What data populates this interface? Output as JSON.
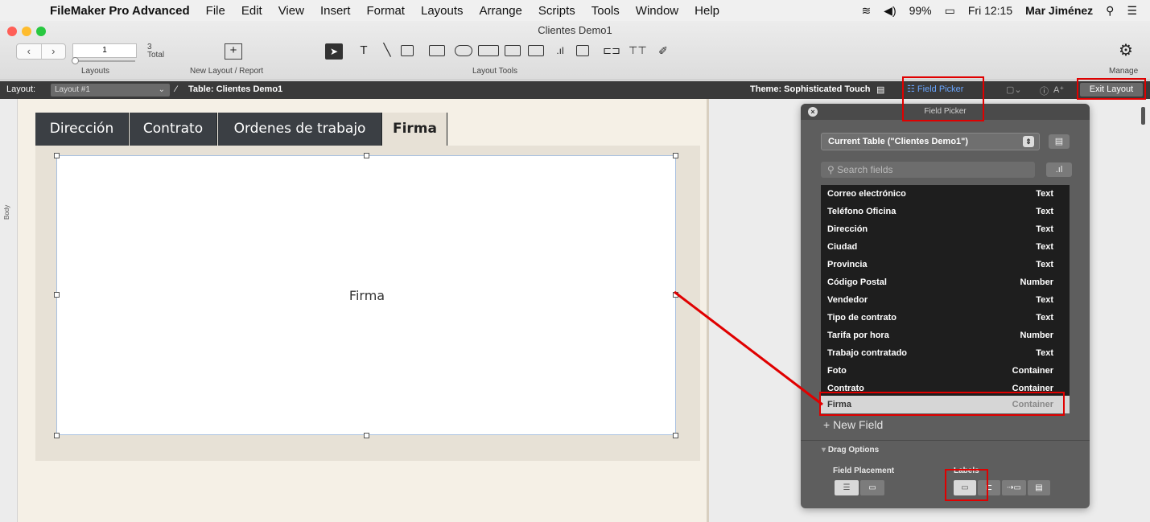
{
  "menubar": {
    "app_name": "FileMaker Pro Advanced",
    "items": [
      "File",
      "Edit",
      "View",
      "Insert",
      "Format",
      "Layouts",
      "Arrange",
      "Scripts",
      "Tools",
      "Window",
      "Help"
    ],
    "battery": "99%",
    "clock": "Fri 12:15",
    "user": "Mar Jiménez"
  },
  "window": {
    "title": "Clientes Demo1"
  },
  "toolbar": {
    "layout_number": "1",
    "layout_total": "3",
    "total_label": "Total",
    "layouts_label": "Layouts",
    "new_layout_label": "New Layout / Report",
    "layout_tools_label": "Layout Tools",
    "manage_label": "Manage"
  },
  "layoutbar": {
    "layout_label": "Layout:",
    "layout_value": "Layout #1",
    "table_label": "Table: Clientes Demo1",
    "theme_label": "Theme: Sophisticated Touch",
    "field_picker_btn": "Field Picker",
    "exit_layout_btn": "Exit Layout"
  },
  "canvas": {
    "part_label": "Body",
    "tabs": [
      {
        "label": "Dirección",
        "active": false
      },
      {
        "label": "Contrato",
        "active": false
      },
      {
        "label": "Ordenes de trabajo",
        "active": false
      },
      {
        "label": "Firma",
        "active": true
      }
    ],
    "field_label": "Firma"
  },
  "picker": {
    "title": "Field Picker",
    "table_select": "Current Table (\"Clientes Demo1\")",
    "search_placeholder": "Search fields",
    "fields": [
      {
        "name": "Correo electrónico",
        "type": "Text",
        "selected": false
      },
      {
        "name": "Teléfono Oficina",
        "type": "Text",
        "selected": false
      },
      {
        "name": "Dirección",
        "type": "Text",
        "selected": false
      },
      {
        "name": "Ciudad",
        "type": "Text",
        "selected": false
      },
      {
        "name": "Provincia",
        "type": "Text",
        "selected": false
      },
      {
        "name": "Código Postal",
        "type": "Number",
        "selected": false
      },
      {
        "name": "Vendedor",
        "type": "Text",
        "selected": false
      },
      {
        "name": "Tipo de contrato",
        "type": "Text",
        "selected": false
      },
      {
        "name": "Tarifa por hora",
        "type": "Number",
        "selected": false
      },
      {
        "name": "Trabajo contratado",
        "type": "Text",
        "selected": false
      },
      {
        "name": "Foto",
        "type": "Container",
        "selected": false
      },
      {
        "name": "Contrato",
        "type": "Container",
        "selected": false
      },
      {
        "name": "Firma",
        "type": "Container",
        "selected": true
      }
    ],
    "new_field": "+ New Field",
    "drag_options": "Drag Options",
    "field_placement": "Field Placement",
    "labels": "Labels"
  },
  "colors": {
    "highlight": "#e00000",
    "tab_dark": "#3b3f44",
    "canvas_bg": "#f5f0e6",
    "panel_bg": "#5e5e5e"
  }
}
